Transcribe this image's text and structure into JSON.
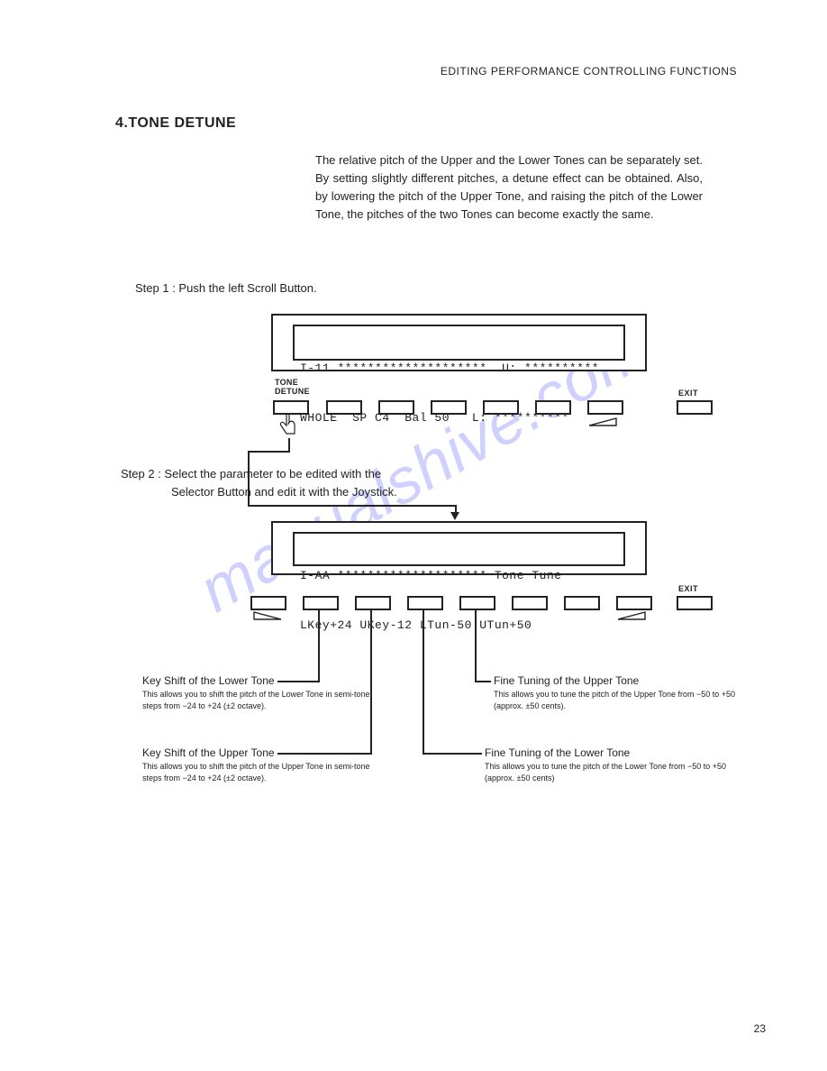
{
  "header": "EDITING PERFORMANCE CONTROLLING FUNCTIONS",
  "section_title": "4.TONE DETUNE",
  "intro": "The relative pitch of the Upper and the Lower Tones can be separately set. By setting slightly different pitches, a detune effect can be obtained. Also, by lowering the pitch of the Upper Tone, and raising the pitch of the Lower Tone, the pitches of the two Tones can become exactly the same.",
  "step1": "Step 1 : Push the left Scroll Button.",
  "step2": "Step 2 : Select the parameter to be edited with the Selector Button and edit it with the Joystick.",
  "display1": {
    "line1": "I-11 ********************  U: **********",
    "line2": "WHOLE  SP C4  Bal 50   L: **********"
  },
  "display2": {
    "line1": "I-AA ******************** Tone Tune",
    "line2": "LKey+24 UKey-12 LTun-50 UTun+50"
  },
  "labels": {
    "tone_detune": "TONE\nDETUNE",
    "exit": "EXIT"
  },
  "callouts": {
    "lkey": {
      "title": "Key Shift of the Lower Tone",
      "desc": "This allows you to shift the pitch of the Lower Tone in semi-tone steps from −24 to +24 (±2 octave)."
    },
    "ukey": {
      "title": "Key Shift of the Upper Tone",
      "desc": "This allows you to shift the pitch of the Upper Tone in semi-tone steps from −24 to +24 (±2 octave)."
    },
    "ltun": {
      "title": "Fine Tuning of the Lower Tone",
      "desc": "This allows you to tune the pitch of the Lower Tone from −50 to +50 (approx. ±50 cents)"
    },
    "utun": {
      "title": "Fine Tuning of the Upper Tone",
      "desc": "This allows you to tune the pitch of the Upper Tone from −50 to +50 (approx. ±50 cents)."
    }
  },
  "watermark": "manualshive.com",
  "page_number": "23"
}
